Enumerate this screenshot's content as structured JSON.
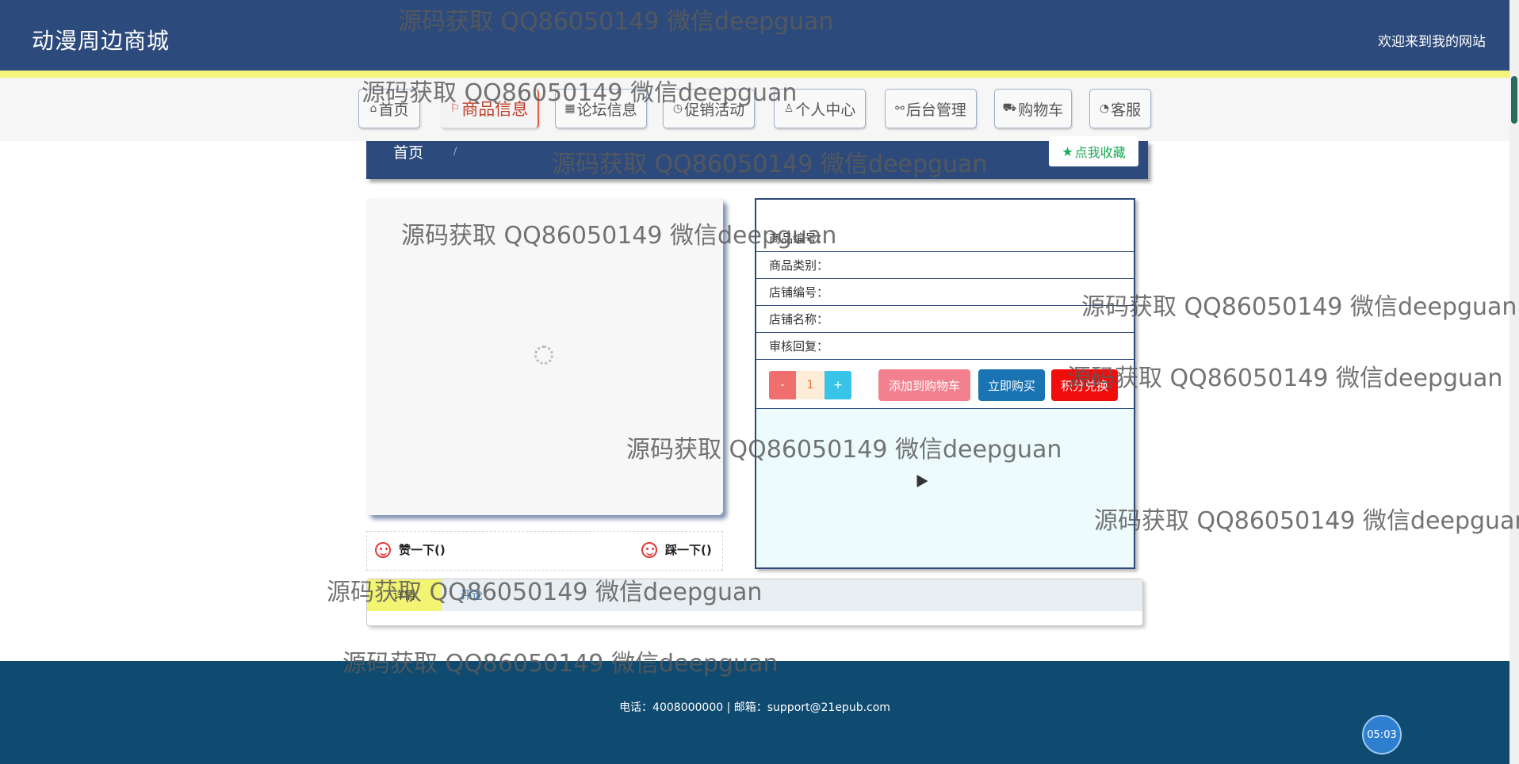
{
  "header": {
    "site_title": "动漫周边商城",
    "welcome": "欢迎来到我的网站"
  },
  "nav": {
    "items": [
      {
        "label": "首页",
        "icon": "home-icon",
        "glyph": "⌂"
      },
      {
        "label": "商品信息",
        "icon": "flag-icon",
        "glyph": "⚐"
      },
      {
        "label": "论坛信息",
        "icon": "grid-icon",
        "glyph": "▦"
      },
      {
        "label": "促销活动",
        "icon": "clock-icon",
        "glyph": "◷"
      },
      {
        "label": "个人中心",
        "icon": "user-icon",
        "glyph": "♙"
      },
      {
        "label": "后台管理",
        "icon": "link-icon",
        "glyph": "⚯"
      },
      {
        "label": "购物车",
        "icon": "cart-icon",
        "glyph": "⛟"
      },
      {
        "label": "客服",
        "icon": "support-icon",
        "glyph": "◔"
      }
    ],
    "active": "商品信息"
  },
  "breadcrumb": {
    "home": "首页",
    "separator": "/",
    "favorite": "点我收藏",
    "favorite_glyph": "★"
  },
  "product": {
    "fields": [
      {
        "label": "商品编号："
      },
      {
        "label": "商品类别："
      },
      {
        "label": "店铺编号："
      },
      {
        "label": "店铺名称："
      },
      {
        "label": "审核回复："
      }
    ],
    "qty_minus": "-",
    "qty_value": "1",
    "qty_plus": "+",
    "add_to_cart": "添加到购物车",
    "buy_now": "立即购买",
    "points_exchange": "积分兑换"
  },
  "vote": {
    "like": "赞一下()",
    "dislike": "踩一下()"
  },
  "tabs": {
    "detail": "详情",
    "review": "评论"
  },
  "footer": {
    "contact": "电话：4008000000 | 邮箱：support@21epub.com"
  },
  "clock": "05:03",
  "watermark": "源码获取 QQ86050149 微信deepguan",
  "colors": {
    "header_bg": "#2c4a7c",
    "accent_yellow": "#f5f37a",
    "footer_bg": "#0f4a70",
    "add_cart": "#f3808e",
    "buy_now": "#1a74b3",
    "points": "#f20d0d"
  }
}
